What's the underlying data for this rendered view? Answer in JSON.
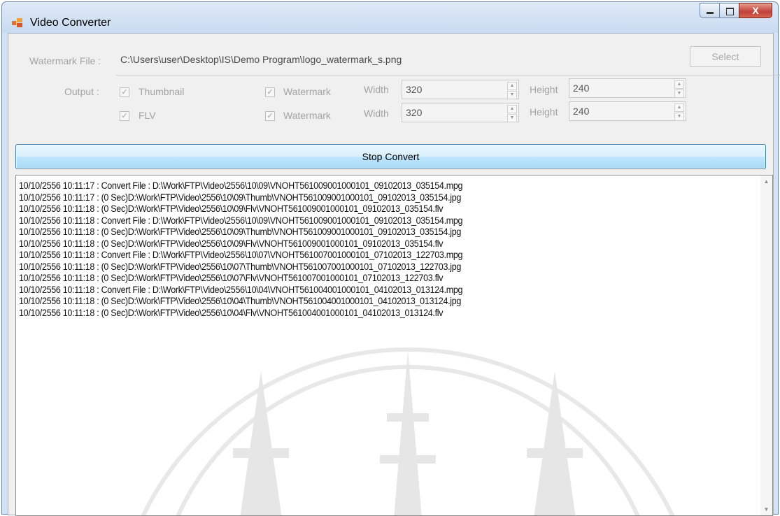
{
  "window": {
    "title": "Video Converter"
  },
  "title_buttons": {
    "minimize": "minimize-icon",
    "maximize": "maximize-icon",
    "close": "X"
  },
  "watermark": {
    "label": "Watermark File :",
    "path": "C:\\Users\\user\\Desktop\\IS\\Demo Program\\logo_watermark_s.png",
    "select_label": "Select"
  },
  "output": {
    "label": "Output :",
    "rows": [
      {
        "type_label": "Thumbnail",
        "type_checked": true,
        "watermark_label": "Watermark",
        "watermark_checked": true,
        "width_label": "Width",
        "width": "320",
        "height_label": "Height",
        "height": "240"
      },
      {
        "type_label": "FLV",
        "type_checked": true,
        "watermark_label": "Watermark",
        "watermark_checked": true,
        "width_label": "Width",
        "width": "320",
        "height_label": "Height",
        "height": "240"
      }
    ]
  },
  "action": {
    "label": "Stop Convert"
  },
  "log": [
    "10/10/2556 10:11:17 : Convert File : D:\\Work\\FTP\\Video\\2556\\10\\09\\VNOHT561009001000101_09102013_035154.mpg",
    "10/10/2556 10:11:17 : (0 Sec)D:\\Work\\FTP\\Video\\2556\\10\\09\\Thumb\\VNOHT561009001000101_09102013_035154.jpg",
    "10/10/2556 10:11:18 : (0 Sec)D:\\Work\\FTP\\Video\\2556\\10\\09\\Flv\\VNOHT561009001000101_09102013_035154.flv",
    "10/10/2556 10:11:18 : Convert File : D:\\Work\\FTP\\Video\\2556\\10\\09\\VNOHT561009001000101_09102013_035154.mpg",
    "10/10/2556 10:11:18 : (0 Sec)D:\\Work\\FTP\\Video\\2556\\10\\09\\Thumb\\VNOHT561009001000101_09102013_035154.jpg",
    "10/10/2556 10:11:18 : (0 Sec)D:\\Work\\FTP\\Video\\2556\\10\\09\\Flv\\VNOHT561009001000101_09102013_035154.flv",
    "10/10/2556 10:11:18 : Convert File : D:\\Work\\FTP\\Video\\2556\\10\\07\\VNOHT561007001000101_07102013_122703.mpg",
    "10/10/2556 10:11:18 : (0 Sec)D:\\Work\\FTP\\Video\\2556\\10\\07\\Thumb\\VNOHT561007001000101_07102013_122703.jpg",
    "10/10/2556 10:11:18 : (0 Sec)D:\\Work\\FTP\\Video\\2556\\10\\07\\Flv\\VNOHT561007001000101_07102013_122703.flv",
    "10/10/2556 10:11:18 : Convert File : D:\\Work\\FTP\\Video\\2556\\10\\04\\VNOHT561004001000101_04102013_013124.mpg",
    "10/10/2556 10:11:18 : (0 Sec)D:\\Work\\FTP\\Video\\2556\\10\\04\\Thumb\\VNOHT561004001000101_04102013_013124.jpg",
    "10/10/2556 10:11:18 : (0 Sec)D:\\Work\\FTP\\Video\\2556\\10\\04\\Flv\\VNOHT561004001000101_04102013_013124.flv"
  ],
  "colors": {
    "disabled_text": "#a3a3a3",
    "button_blue": "#bee6fd",
    "close_red": "#c0413a"
  }
}
